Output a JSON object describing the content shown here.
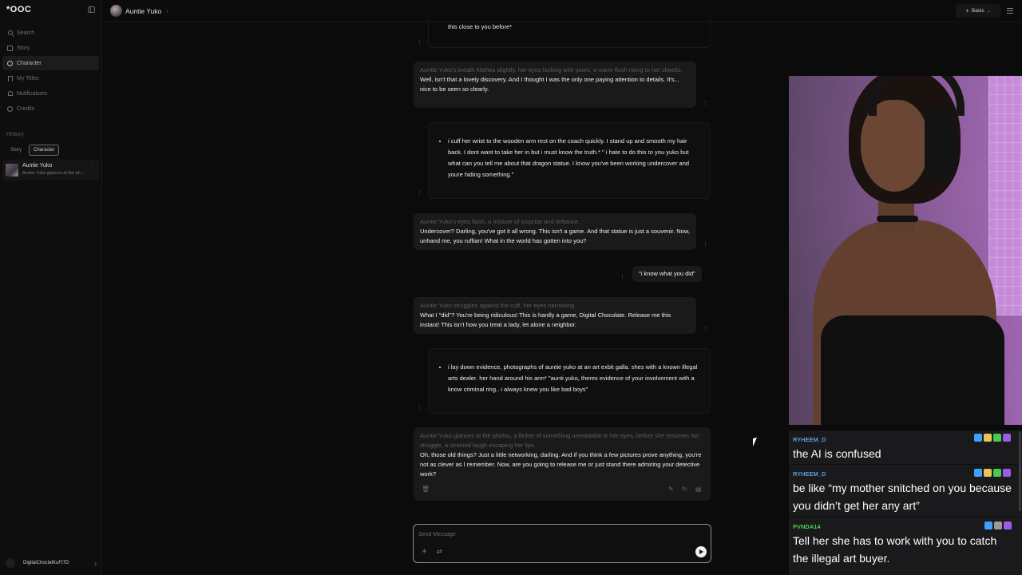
{
  "sidebar": {
    "logo": "*OOC",
    "nav": [
      "Search",
      "Story",
      "Character",
      "My Titles",
      "Notifications",
      "Credits"
    ],
    "history_label": "History",
    "filters": [
      "Story",
      "Character"
    ],
    "history_item": {
      "name": "Auntie Yuko",
      "preview": "Auntie Yuko glances at the ph..."
    },
    "username": "DigitalChoclatKuFt7D"
  },
  "header": {
    "character": "Auntie Yuko",
    "mode": "Basic"
  },
  "messages": {
    "m0_user": "this close to you before*",
    "m1_narr": "Auntie Yuko's breath hitches slightly, her eyes locking with yours, a warm flush rising to her cheeks.",
    "m1_text": "Well, isn't that a lovely discovery. And I thought I was the only one paying attention to details. It's... nice to be seen so clearly.",
    "m2_user": "i cuff her wrist to the wooden arm rest on the coach quickly. I stand up and smooth my hair back. I dont want to take her in but i must know the truth.* \" i hate to do this to you yuko but what can you tell me about that dragon statue. I know you've been working undercover and youre hiding something.\"",
    "m3_narr": "Auntie Yuko's eyes flash, a mixture of surprise and defiance.",
    "m3_text": "Undercover? Darling, you've got it all wrong. This isn't a game. And that statue is just a souvenir. Now, unhand me, you ruffian! What in the world has gotten into you?",
    "m4_user": "\"i know what you did\"",
    "m5_narr": "Auntie Yuko struggles against the cuff, her eyes narrowing.",
    "m5_text": "What I \"did\"? You're being ridiculous! This is hardly a game, Digital Chocolate. Release me this instant! This isn't how you treat a lady, let alone a neighbor.",
    "m6_user": "i lay down evidence, photographs of auntie yuko at an art exbit galla. shes with a known illegal arts dealer. her hand around his arm* \"aunti yuko, theres evidence of your involvement with a know criminal ring.. i always knew you like bad boys\"",
    "m7_narr": "Auntie Yuko glances at the photos, a flicker of something unreadable in her eyes, before she resumes her struggle, a strained laugh escaping her lips.",
    "m7_text": "Oh, those old things? Just a little networking, darling. And if you think a few pictures prove anything, you're not as clever as I remember. Now, are you going to release me or just stand there admiring your detective work?"
  },
  "composer": {
    "placeholder": "Send Message"
  },
  "stream_chat": [
    {
      "user": "RYHEEM_D",
      "color": "#5b9bd5",
      "text": "the AI is confused"
    },
    {
      "user": "RYHEEM_D",
      "color": "#5b9bd5",
      "text": "be like “my mother snitched on you because you didn’t get her any art”"
    },
    {
      "user": "PVNDA14",
      "color": "#4ec94e",
      "text": "Tell her she has to work with you to catch the illegal art buyer."
    }
  ],
  "colors": {
    "badge_prime": "#3fa0ff",
    "badge_gold": "#e8c45a",
    "badge_green": "#4cc94c",
    "badge_purple": "#9b5de5"
  }
}
